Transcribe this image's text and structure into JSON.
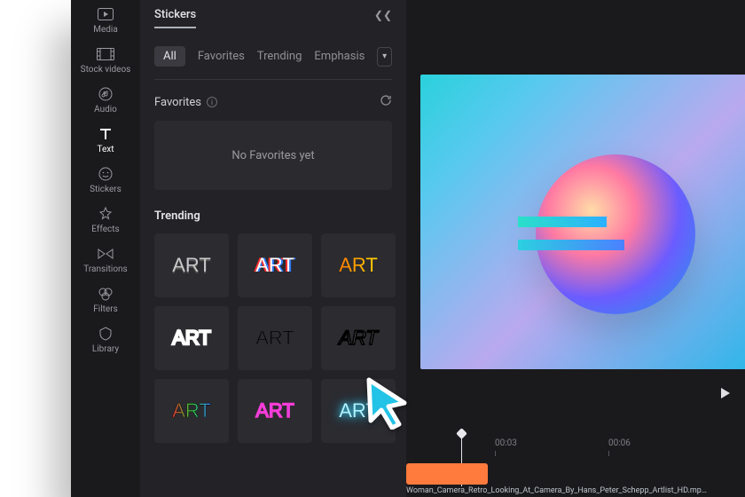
{
  "rail": [
    {
      "id": "media",
      "label": "Media"
    },
    {
      "id": "stockvideos",
      "label": "Stock videos"
    },
    {
      "id": "audio",
      "label": "Audio"
    },
    {
      "id": "text",
      "label": "Text"
    },
    {
      "id": "stickers",
      "label": "Stickers"
    },
    {
      "id": "effects",
      "label": "Effects"
    },
    {
      "id": "transitions",
      "label": "Transitions"
    },
    {
      "id": "filters",
      "label": "Filters"
    },
    {
      "id": "library",
      "label": "Library"
    }
  ],
  "panel": {
    "title": "Stickers",
    "tabs": [
      "All",
      "Favorites",
      "Trending",
      "Emphasis"
    ],
    "active_tab": "All",
    "favorites": {
      "heading": "Favorites",
      "empty_text": "No Favorites yet"
    },
    "trending": {
      "heading": "Trending",
      "thumb_text": "ART"
    }
  },
  "timeline": {
    "ticks": [
      "00:03",
      "00:06"
    ],
    "clip_label": "Woman_Camera_Retro_Looking_At_Camera_By_Hans_Peter_Schepp_Artlist_HD.mp…"
  }
}
